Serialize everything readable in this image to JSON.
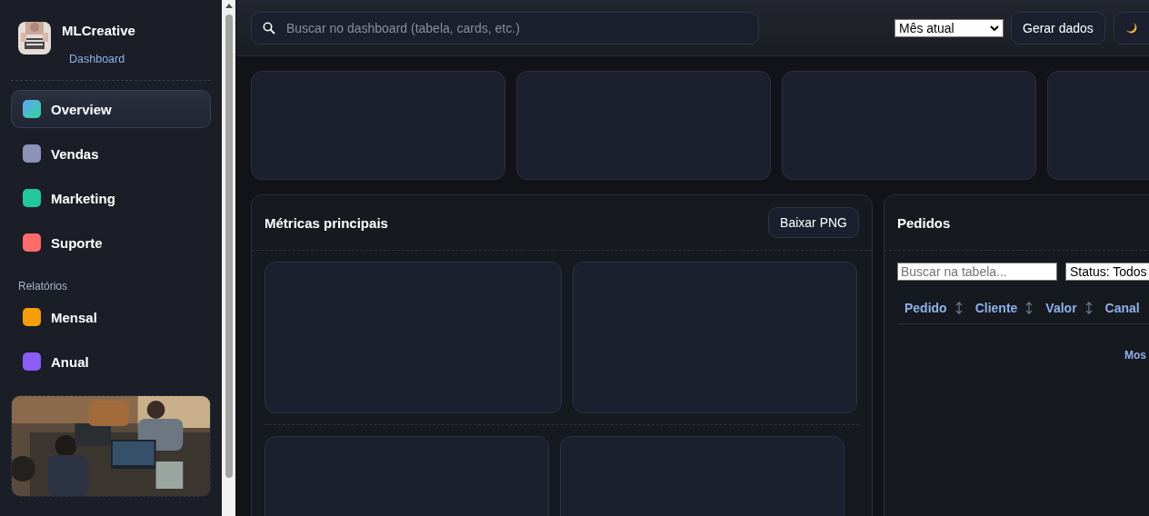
{
  "brand": {
    "name": "MLCreative",
    "subtitle": "Dashboard"
  },
  "nav": [
    {
      "label": "Overview",
      "selected": true,
      "color": "#5fb3e8"
    },
    {
      "label": "Vendas",
      "selected": false,
      "color": "#8b93b8"
    },
    {
      "label": "Marketing",
      "selected": false,
      "color": "#22c79a"
    },
    {
      "label": "Suporte",
      "selected": false,
      "color": "#ff6b6b"
    }
  ],
  "reports": {
    "heading": "Relatórios",
    "items": [
      {
        "label": "Mensal",
        "selected": false,
        "color": "#f59e0b"
      },
      {
        "label": "Anual",
        "selected": false,
        "color": "#8b5cf6"
      }
    ]
  },
  "topbar": {
    "search": {
      "placeholder": "Buscar no dashboard (tabela, cards, etc.)"
    },
    "period": {
      "value": "Mês atual"
    },
    "generate_button": "Gerar dados"
  },
  "kpi_cards": [
    {
      "kind": "empty"
    },
    {
      "kind": "empty"
    },
    {
      "kind": "empty"
    },
    {
      "kind": "empty"
    }
  ],
  "metrics": {
    "title": "Métricas principais",
    "download_button": "Baixar PNG",
    "slots": [
      {
        "kind": "empty"
      },
      {
        "kind": "empty"
      },
      {
        "kind": "empty"
      },
      {
        "kind": "empty"
      }
    ]
  },
  "orders": {
    "title": "Pedidos",
    "search": {
      "placeholder": "Buscar na tabela..."
    },
    "status": {
      "value": "Status: Todos"
    },
    "columns": [
      {
        "label": "Pedido",
        "sortable": true
      },
      {
        "label": "Cliente",
        "sortable": true
      },
      {
        "label": "Valor",
        "sortable": true
      },
      {
        "label": "Canal",
        "sortable": false
      }
    ],
    "footer": "Mos"
  }
}
